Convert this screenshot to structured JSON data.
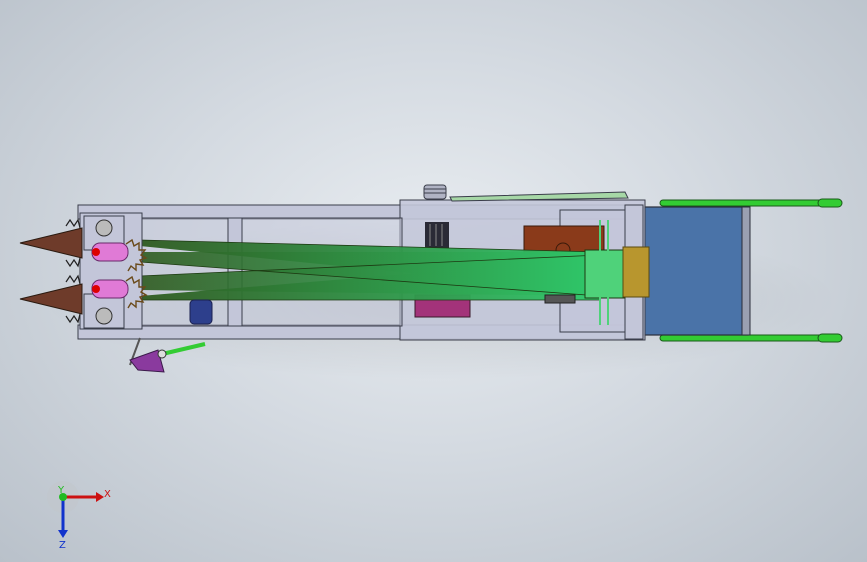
{
  "view": {
    "background_top": "#e9edf1",
    "background_bottom": "#b9c1ca"
  },
  "model": {
    "frame_color": "#c3c6d9",
    "frame_stroke": "#3a3d4a",
    "belt_color_start": "#2e5a1f",
    "belt_color_end": "#2fc86a",
    "cutter_color": "#6e3b2a",
    "handle_bar_color": "#33cc33",
    "rear_panel_color": "#4a73a8",
    "box_brown_color": "#8a3a1a",
    "box_magenta_color": "#a3337a",
    "roller_pink_color": "#e07ad6",
    "gearbox_color": "#b8962e",
    "motor_blue_color": "#2d3f8c",
    "lever_purple_color": "#8a3a9e"
  },
  "triad": {
    "x_label": "X",
    "y_label": "Y",
    "z_label": "Z",
    "x_color": "#cc1111",
    "y_color": "#22bb22",
    "z_color": "#1133cc"
  }
}
